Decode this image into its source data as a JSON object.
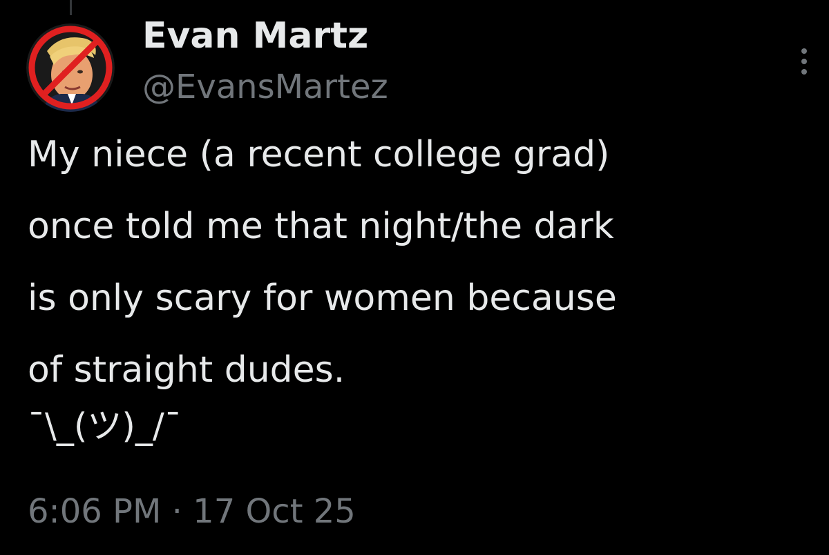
{
  "tweet": {
    "author": {
      "display_name": "Evan Martz",
      "handle": "@EvansMartez",
      "avatar_icon": "avatar-with-prohibition-sign"
    },
    "text_lines": [
      "My niece (a recent college grad)",
      "once told me that night/the dark",
      "is only scary for women because",
      "of straight dudes."
    ],
    "emoticon": "¯\\_(ツ)_/¯",
    "timestamp": "6:06 PM · 17 Oct 25",
    "more_icon": "more-vertical-icon"
  },
  "colors": {
    "background": "#000000",
    "primary_text": "#e7e9ea",
    "secondary_text": "#71767b",
    "prohibition_red": "#e02020"
  }
}
